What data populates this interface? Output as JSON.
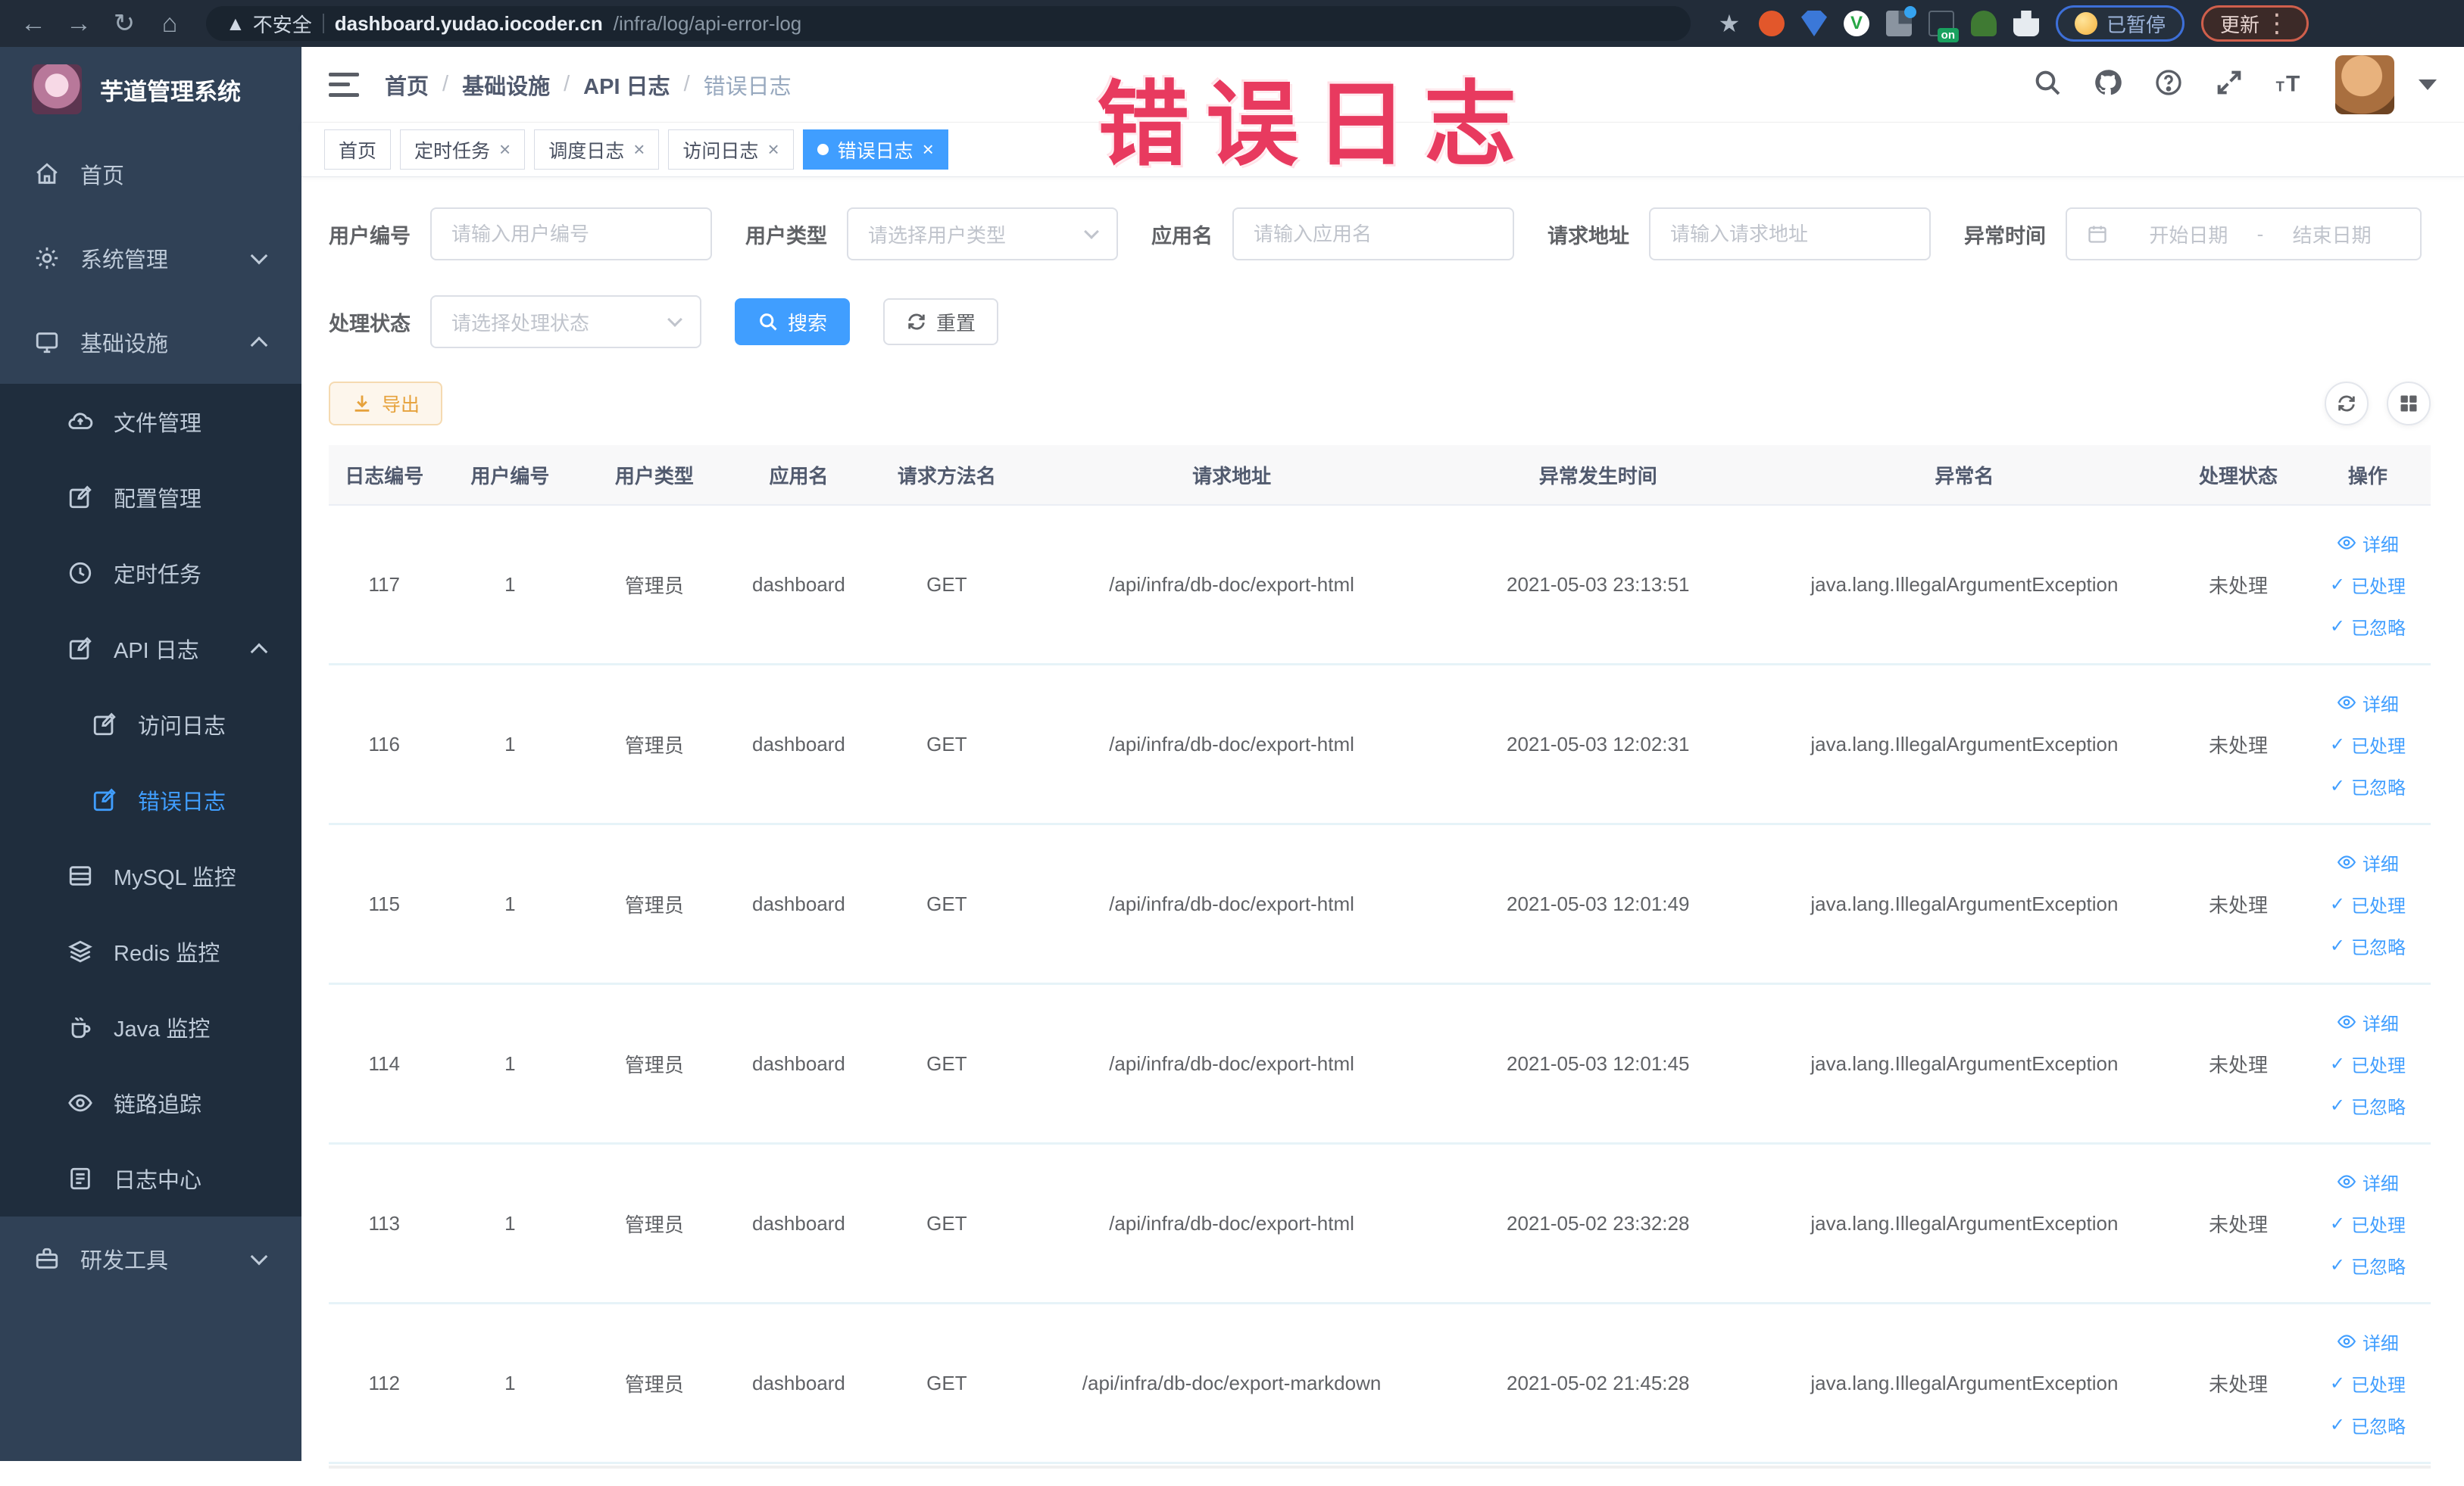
{
  "colors": {
    "accent": "#409eff",
    "warning": "#e6a23c",
    "annotation_red": "#e83a5f",
    "sidebar_bg": "#304156",
    "submenu_bg": "#1f2d3d"
  },
  "annotation": {
    "text": "错误日志"
  },
  "browser": {
    "security_label": "不安全",
    "url_domain": "dashboard.yudao.iocoder.cn",
    "url_path": "/infra/log/api-error-log",
    "paused_label": "已暂停",
    "update_label": "更新"
  },
  "sidebar": {
    "title": "芋道管理系统",
    "items": [
      {
        "label": "首页",
        "icon": "home-icon",
        "depth": 0
      },
      {
        "label": "系统管理",
        "icon": "gear-icon",
        "depth": 0,
        "chevron": "down"
      },
      {
        "label": "基础设施",
        "icon": "monitor-icon",
        "depth": 0,
        "chevron": "up"
      },
      {
        "label": "文件管理",
        "icon": "cloud-icon",
        "depth": 1
      },
      {
        "label": "配置管理",
        "icon": "edit-icon",
        "depth": 1
      },
      {
        "label": "定时任务",
        "icon": "clock-icon",
        "depth": 1
      },
      {
        "label": "API 日志",
        "icon": "log-icon",
        "depth": 1,
        "chevron": "up"
      },
      {
        "label": "访问日志",
        "icon": "log-icon",
        "depth": 2
      },
      {
        "label": "错误日志",
        "icon": "log-icon",
        "depth": 2,
        "active": true
      },
      {
        "label": "MySQL 监控",
        "icon": "db-icon",
        "depth": 1
      },
      {
        "label": "Redis 监控",
        "icon": "layers-icon",
        "depth": 1
      },
      {
        "label": "Java 监控",
        "icon": "java-icon",
        "depth": 1
      },
      {
        "label": "链路追踪",
        "icon": "eye-icon",
        "depth": 1
      },
      {
        "label": "日志中心",
        "icon": "doc-icon",
        "depth": 1
      },
      {
        "label": "研发工具",
        "icon": "toolbox-icon",
        "depth": 0,
        "chevron": "down"
      }
    ]
  },
  "header": {
    "breadcrumb": [
      "首页",
      "基础设施",
      "API 日志",
      "错误日志"
    ]
  },
  "tabs": [
    {
      "label": "首页"
    },
    {
      "label": "定时任务",
      "closable": true
    },
    {
      "label": "调度日志",
      "closable": true
    },
    {
      "label": "访问日志",
      "closable": true
    },
    {
      "label": "错误日志",
      "closable": true,
      "active": true
    }
  ],
  "filters": {
    "user_id": {
      "label": "用户编号",
      "placeholder": "请输入用户编号"
    },
    "user_type": {
      "label": "用户类型",
      "placeholder": "请选择用户类型"
    },
    "app_name": {
      "label": "应用名",
      "placeholder": "请输入应用名"
    },
    "req_url": {
      "label": "请求地址",
      "placeholder": "请输入请求地址"
    },
    "date": {
      "label": "异常时间",
      "start": "开始日期",
      "sep": "-",
      "end": "结束日期"
    },
    "status": {
      "label": "处理状态",
      "placeholder": "请选择处理状态"
    },
    "search_label": "搜索",
    "reset_label": "重置"
  },
  "toolbar": {
    "export_label": "导出"
  },
  "table": {
    "columns": [
      "日志编号",
      "用户编号",
      "用户类型",
      "应用名",
      "请求方法名",
      "请求地址",
      "异常发生时间",
      "异常名",
      "处理状态",
      "操作"
    ],
    "actions": [
      "详细",
      "已处理",
      "已忽略"
    ],
    "rows": [
      {
        "id": "117",
        "user_id": "1",
        "user_type": "管理员",
        "app": "dashboard",
        "method": "GET",
        "url": "/api/infra/db-doc/export-html",
        "time": "2021-05-03 23:13:51",
        "exception": "java.lang.IllegalArgumentException",
        "status": "未处理"
      },
      {
        "id": "116",
        "user_id": "1",
        "user_type": "管理员",
        "app": "dashboard",
        "method": "GET",
        "url": "/api/infra/db-doc/export-html",
        "time": "2021-05-03 12:02:31",
        "exception": "java.lang.IllegalArgumentException",
        "status": "未处理"
      },
      {
        "id": "115",
        "user_id": "1",
        "user_type": "管理员",
        "app": "dashboard",
        "method": "GET",
        "url": "/api/infra/db-doc/export-html",
        "time": "2021-05-03 12:01:49",
        "exception": "java.lang.IllegalArgumentException",
        "status": "未处理"
      },
      {
        "id": "114",
        "user_id": "1",
        "user_type": "管理员",
        "app": "dashboard",
        "method": "GET",
        "url": "/api/infra/db-doc/export-html",
        "time": "2021-05-03 12:01:45",
        "exception": "java.lang.IllegalArgumentException",
        "status": "未处理"
      },
      {
        "id": "113",
        "user_id": "1",
        "user_type": "管理员",
        "app": "dashboard",
        "method": "GET",
        "url": "/api/infra/db-doc/export-html",
        "time": "2021-05-02 23:32:28",
        "exception": "java.lang.IllegalArgumentException",
        "status": "未处理"
      },
      {
        "id": "112",
        "user_id": "1",
        "user_type": "管理员",
        "app": "dashboard",
        "method": "GET",
        "url": "/api/infra/db-doc/export-markdown",
        "time": "2021-05-02 21:45:28",
        "exception": "java.lang.IllegalArgumentException",
        "status": "未处理"
      }
    ]
  }
}
